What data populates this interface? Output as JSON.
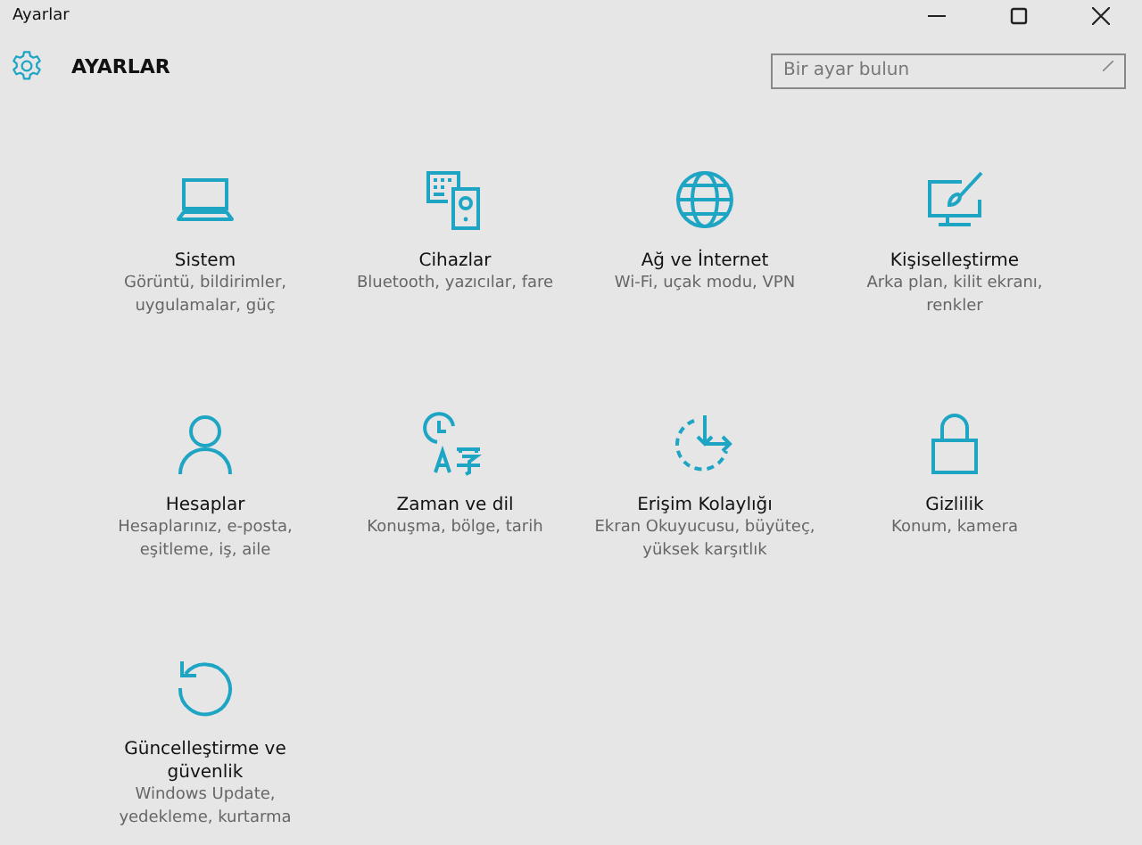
{
  "window": {
    "title": "Ayarlar"
  },
  "header": {
    "title": "AYARLAR"
  },
  "search": {
    "placeholder": "Bir ayar bulun"
  },
  "tiles": [
    {
      "kind": "laptop",
      "title": "Sistem",
      "description": "Görüntü, bildirimler, uygulamalar, güç"
    },
    {
      "kind": "devices",
      "title": "Cihazlar",
      "description": "Bluetooth, yazıcılar, fare"
    },
    {
      "kind": "globe",
      "title": "Ağ ve İnternet",
      "description": "Wi-Fi, uçak modu, VPN"
    },
    {
      "kind": "paint",
      "title": "Kişiselleştirme",
      "description": "Arka plan, kilit ekranı, renkler"
    },
    {
      "kind": "person",
      "title": "Hesaplar",
      "description": "Hesaplarınız, e-posta, eşitleme, iş, aile"
    },
    {
      "kind": "language",
      "title": "Zaman ve dil",
      "description": "Konuşma, bölge, tarih"
    },
    {
      "kind": "access",
      "title": "Erişim Kolaylığı",
      "description": "Ekran Okuyucusu, büyüteç, yüksek karşıtlık"
    },
    {
      "kind": "lock",
      "title": "Gizlilik",
      "description": "Konum, kamera"
    },
    {
      "kind": "refresh",
      "title": "Güncelleştirme ve güvenlik",
      "description": "Windows Update, yedekleme, kurtarma"
    }
  ]
}
